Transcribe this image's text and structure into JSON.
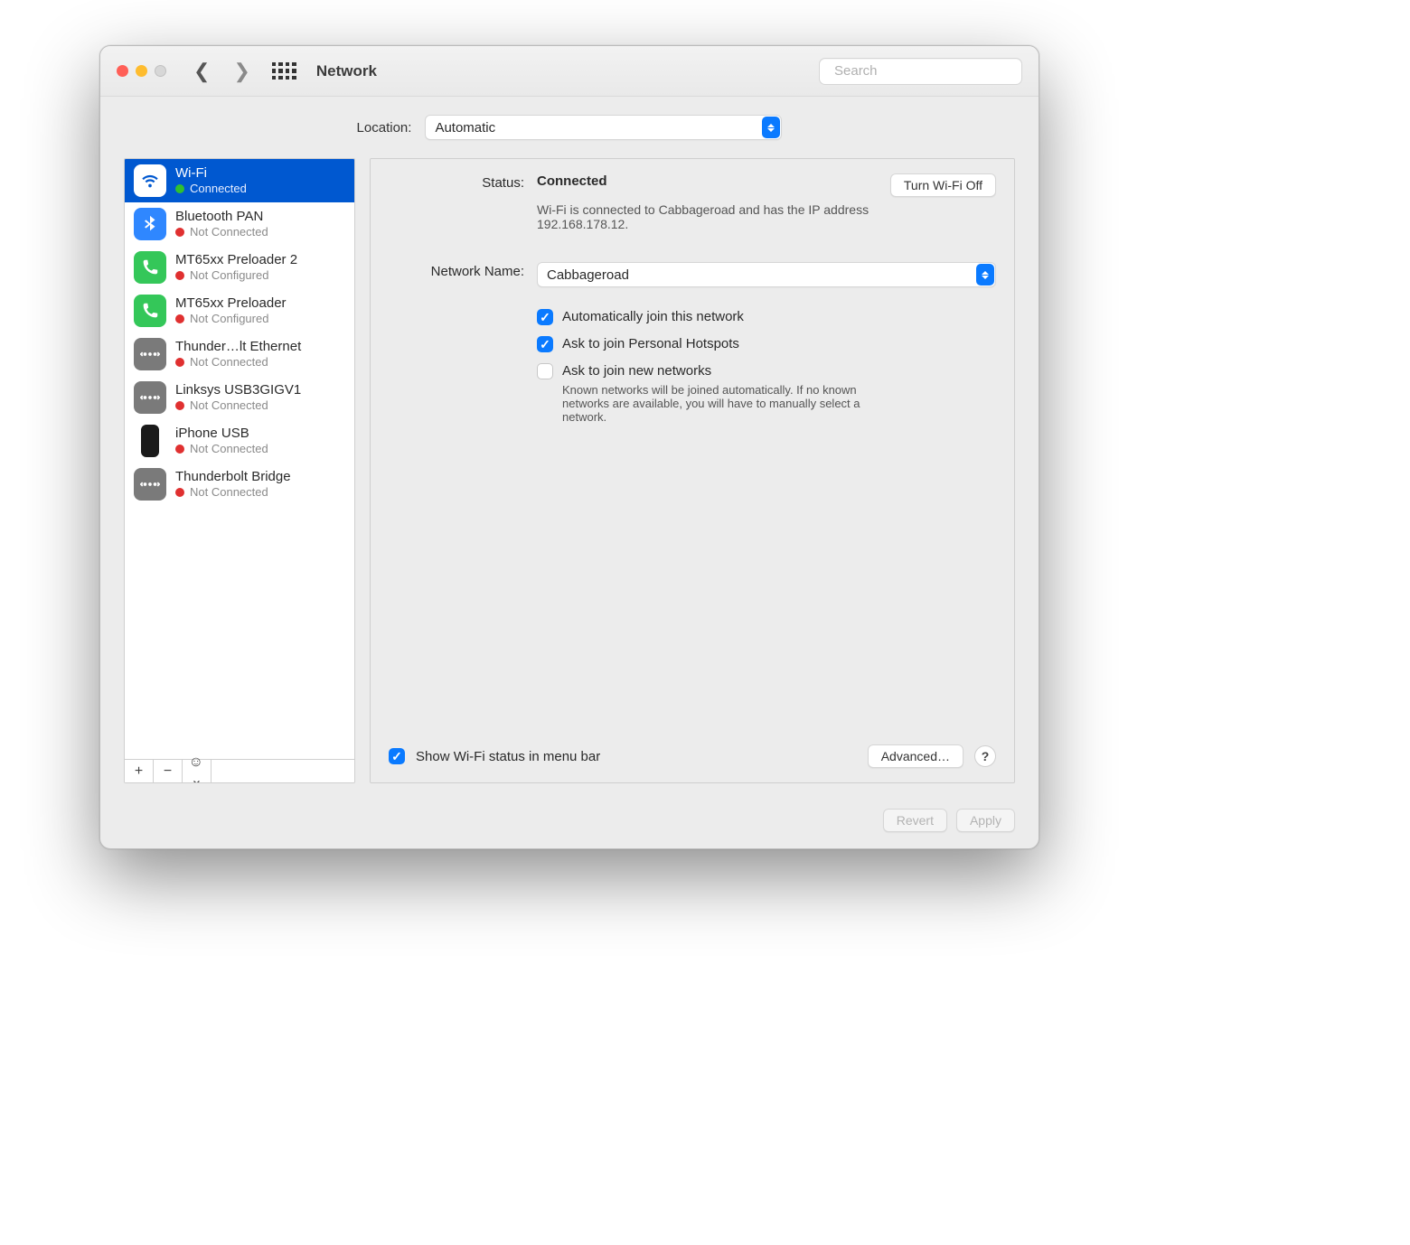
{
  "toolbar": {
    "title": "Network",
    "search_placeholder": "Search"
  },
  "location": {
    "label": "Location:",
    "value": "Automatic"
  },
  "sidebar": {
    "items": [
      {
        "name": "Wi-Fi",
        "status": "Connected",
        "dot": "green",
        "icon": "wifi",
        "selected": true
      },
      {
        "name": "Bluetooth PAN",
        "status": "Not Connected",
        "dot": "red",
        "icon": "bluetooth"
      },
      {
        "name": "MT65xx Preloader 2",
        "status": "Not Configured",
        "dot": "red",
        "icon": "phone-green"
      },
      {
        "name": "MT65xx Preloader",
        "status": "Not Configured",
        "dot": "red",
        "icon": "phone-green"
      },
      {
        "name": "Thunder…lt Ethernet",
        "status": "Not Connected",
        "dot": "red",
        "icon": "ethernet"
      },
      {
        "name": "Linksys USB3GIGV1",
        "status": "Not Connected",
        "dot": "red",
        "icon": "ethernet"
      },
      {
        "name": "iPhone USB",
        "status": "Not Connected",
        "dot": "red",
        "icon": "iphone"
      },
      {
        "name": "Thunderbolt Bridge",
        "status": "Not Connected",
        "dot": "red",
        "icon": "ethernet"
      }
    ]
  },
  "main": {
    "status_label": "Status:",
    "status_value": "Connected",
    "toggle_button": "Turn Wi-Fi Off",
    "status_sub": "Wi-Fi is connected to Cabbageroad and has the IP address 192.168.178.12.",
    "network_name_label": "Network Name:",
    "network_name_value": "Cabbageroad",
    "cb_auto_join": "Automatically join this network",
    "cb_personal_hotspots": "Ask to join Personal Hotspots",
    "cb_ask_new": "Ask to join new networks",
    "ask_new_hint": "Known networks will be joined automatically. If no known networks are available, you will have to manually select a network.",
    "cb_show_menubar": "Show Wi-Fi status in menu bar",
    "advanced_button": "Advanced…",
    "help_button": "?"
  },
  "bottom": {
    "revert": "Revert",
    "apply": "Apply"
  }
}
